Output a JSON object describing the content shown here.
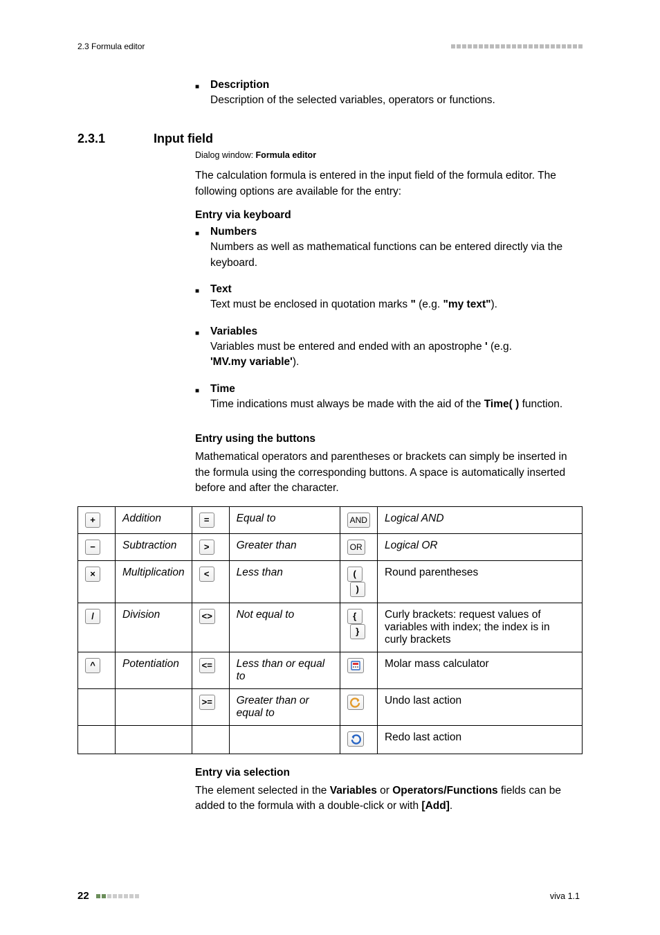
{
  "header": {
    "section_ref": "2.3 Formula editor"
  },
  "desc_block": {
    "title": "Description",
    "text": "Description of the selected variables, operators or functions."
  },
  "section": {
    "number": "2.3.1",
    "title": "Input field",
    "dialog_prefix": "Dialog window: ",
    "dialog_bold": "Formula editor",
    "intro": "The calculation formula is entered in the input field of the formula editor. The following options are available for the entry:"
  },
  "keyboard": {
    "heading": "Entry via keyboard",
    "items": {
      "numbers": {
        "title": "Numbers",
        "text": "Numbers as well as mathematical functions can be entered directly via the keyboard."
      },
      "text": {
        "title": "Text",
        "prefix": "Text must be enclosed in quotation marks ",
        "q1": "\"",
        "eg_open": " (e.g. ",
        "eg_bold": "\"my text\"",
        "eg_close": ")."
      },
      "variables": {
        "title": "Variables",
        "line1_prefix": "Variables must be entered and ended with an apostrophe ",
        "apos": "'",
        "line1_suffix": " (e.g.",
        "line2_bold": "'MV.my variable'",
        "line2_suffix": ")."
      },
      "time": {
        "title": "Time",
        "prefix": "Time indications must always be made with the aid of the ",
        "fn": "Time( )",
        "suffix": " function."
      }
    }
  },
  "buttons_block": {
    "heading": "Entry using the buttons",
    "text": "Mathematical operators and parentheses or brackets can simply be inserted in the formula using the corresponding buttons. A space is automatically inserted before and after the character."
  },
  "ops": {
    "r1": {
      "a": "Addition",
      "b": "Equal to",
      "c": "Logical AND",
      "and": "AND"
    },
    "r2": {
      "a": "Subtraction",
      "b": "Greater than",
      "c": "Logical OR",
      "or": "OR"
    },
    "r3": {
      "a": "Multiplication",
      "b": "Less than",
      "c": "Round parentheses"
    },
    "r4": {
      "a": "Division",
      "b": "Not equal to",
      "c": "Curly brackets: request values of variables with index; the index is in curly brackets"
    },
    "r5": {
      "a": "Potentiation",
      "b": "Less than or equal to",
      "c": "Molar mass calculator"
    },
    "r6": {
      "b": "Greater than or equal to",
      "c": "Undo last action"
    },
    "r7": {
      "c": "Redo last action"
    }
  },
  "selection": {
    "heading": "Entry via selection",
    "prefix": "The element selected in the ",
    "b1": "Variables",
    "mid": " or ",
    "b2": "Operators/Functions",
    "after": " fields can be added to the formula with a double-click or with ",
    "add": "[Add]",
    "end": "."
  },
  "footer": {
    "page": "22",
    "version": "viva 1.1"
  }
}
